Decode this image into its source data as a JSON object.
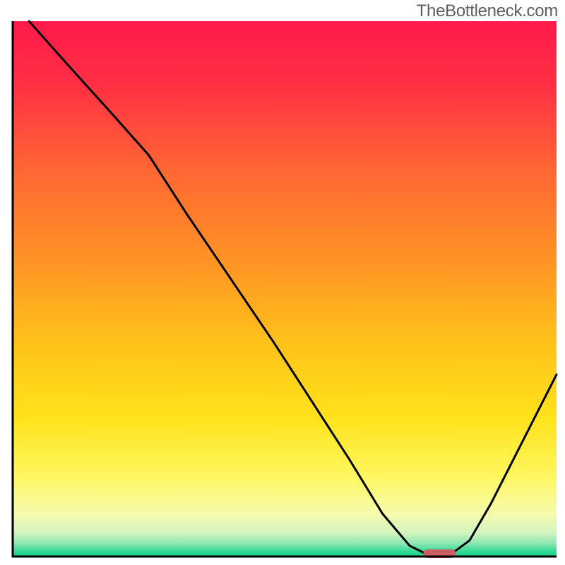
{
  "watermark": "TheBottleneck.com",
  "chart_data": {
    "type": "line",
    "title": "",
    "xlabel": "",
    "ylabel": "",
    "xlim": [
      0,
      100
    ],
    "ylim": [
      0,
      100
    ],
    "grid": false,
    "series": [
      {
        "name": "bottleneck-curve",
        "x": [
          3,
          10,
          18,
          25,
          32,
          40,
          48,
          55,
          62,
          68,
          73,
          77,
          80,
          84,
          88,
          92,
          96,
          100
        ],
        "y": [
          100,
          92,
          83,
          75,
          64,
          52,
          40,
          29,
          18,
          8,
          2,
          0,
          0,
          3,
          10,
          18,
          26,
          34
        ]
      }
    ],
    "marker": {
      "x_center": 78.5,
      "y": 0,
      "width": 6,
      "height": 1.6,
      "color": "#cb5e63"
    },
    "gradient_stops": [
      {
        "offset": 0.0,
        "color": "#ff1a4a"
      },
      {
        "offset": 0.12,
        "color": "#ff3044"
      },
      {
        "offset": 0.28,
        "color": "#ff6733"
      },
      {
        "offset": 0.45,
        "color": "#ff9425"
      },
      {
        "offset": 0.6,
        "color": "#ffc21a"
      },
      {
        "offset": 0.74,
        "color": "#ffe21a"
      },
      {
        "offset": 0.85,
        "color": "#fff760"
      },
      {
        "offset": 0.92,
        "color": "#f6fbae"
      },
      {
        "offset": 0.955,
        "color": "#d6f4c0"
      },
      {
        "offset": 0.975,
        "color": "#8fe8b3"
      },
      {
        "offset": 0.99,
        "color": "#35d997"
      },
      {
        "offset": 1.0,
        "color": "#11cf87"
      }
    ],
    "frame": {
      "stroke": "#000000",
      "stroke_width": 3
    }
  }
}
